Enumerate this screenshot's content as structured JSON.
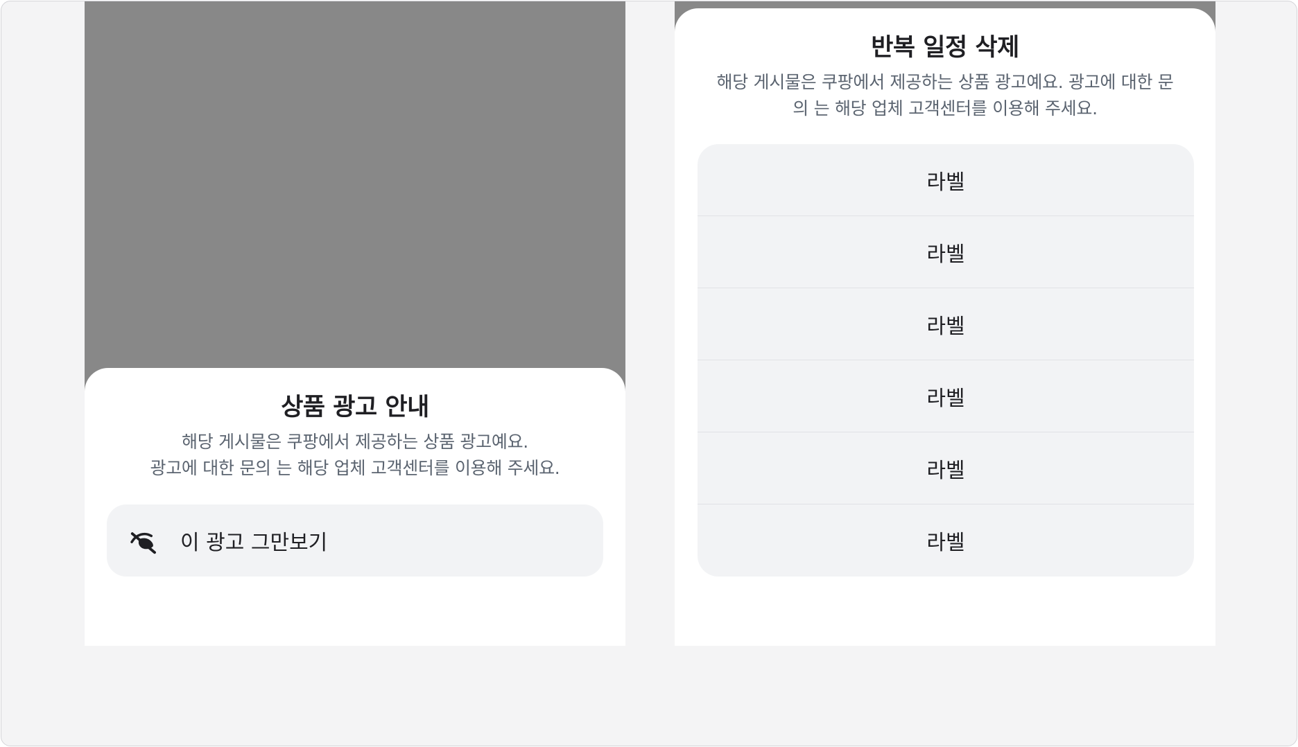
{
  "left_sheet": {
    "title": "상품 광고 안내",
    "description_lines": [
      "해당 게시물은 쿠팡에서 제공하는 상품 광고예요.",
      "광고에 대한 문의 는 해당 업체 고객센터를 이용해 주세요."
    ],
    "action": {
      "icon": "eye-off-icon",
      "label": "이 광고 그만보기"
    }
  },
  "right_sheet": {
    "title": "반복 일정 삭제",
    "description_lines": [
      "해당 게시물은 쿠팡에서 제공하는 상품 광고예요. 광고에 대한 문",
      "의 는 해당 업체 고객센터를 이용해 주세요."
    ],
    "options": [
      {
        "label": "라벨"
      },
      {
        "label": "라벨"
      },
      {
        "label": "라벨"
      },
      {
        "label": "라벨"
      },
      {
        "label": "라벨"
      },
      {
        "label": "라벨"
      }
    ]
  },
  "colors": {
    "canvas_bg": "#f4f4f5",
    "dim_overlay": "#888888",
    "sheet_bg": "#ffffff",
    "item_bg": "#f2f3f5",
    "title_text": "#1f1f23",
    "desc_text": "#5b6470"
  }
}
